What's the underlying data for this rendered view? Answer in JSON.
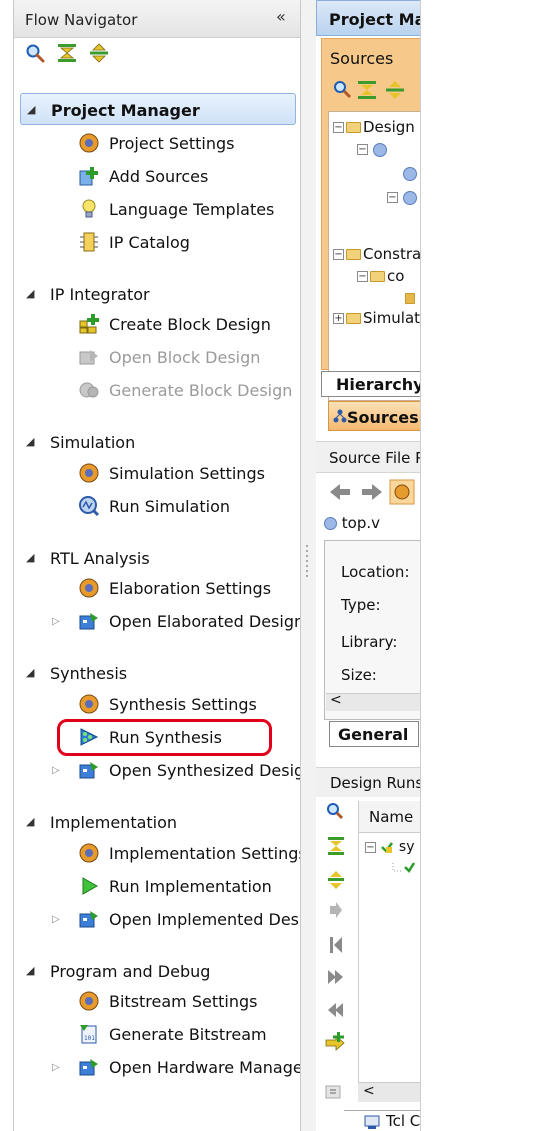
{
  "flow_navigator": {
    "title": "Flow Navigator",
    "collapse_glyph": "«",
    "toolbar": [
      "search-icon",
      "collapse-all-icon",
      "expand-all-icon"
    ],
    "sections": [
      {
        "label": "Project Manager",
        "selected": true,
        "items": [
          {
            "label": "Project Settings",
            "icon": "gear-icon"
          },
          {
            "label": "Add Sources",
            "icon": "add-sources-icon"
          },
          {
            "label": "Language Templates",
            "icon": "lightbulb-icon"
          },
          {
            "label": "IP Catalog",
            "icon": "ip-chip-icon"
          }
        ]
      },
      {
        "label": "IP Integrator",
        "items": [
          {
            "label": "Create Block Design",
            "icon": "create-block-design-icon"
          },
          {
            "label": "Open Block Design",
            "icon": "open-block-design-icon",
            "disabled": true
          },
          {
            "label": "Generate Block Design",
            "icon": "generate-block-design-icon",
            "disabled": true
          }
        ]
      },
      {
        "label": "Simulation",
        "items": [
          {
            "label": "Simulation Settings",
            "icon": "gear-icon"
          },
          {
            "label": "Run Simulation",
            "icon": "simulation-icon"
          }
        ]
      },
      {
        "label": "RTL Analysis",
        "items": [
          {
            "label": "Elaboration Settings",
            "icon": "gear-icon"
          },
          {
            "label": "Open Elaborated Design",
            "icon": "open-design-icon",
            "expandable": true
          }
        ]
      },
      {
        "label": "Synthesis",
        "items": [
          {
            "label": "Synthesis Settings",
            "icon": "gear-icon"
          },
          {
            "label": "Run Synthesis",
            "icon": "run-synthesis-icon",
            "highlighted": true
          },
          {
            "label": "Open Synthesized Design",
            "icon": "open-design-icon",
            "expandable": true
          }
        ]
      },
      {
        "label": "Implementation",
        "items": [
          {
            "label": "Implementation Settings",
            "icon": "gear-icon"
          },
          {
            "label": "Run Implementation",
            "icon": "play-icon"
          },
          {
            "label": "Open Implemented Design",
            "icon": "open-design-icon",
            "expandable": true
          }
        ]
      },
      {
        "label": "Program and Debug",
        "items": [
          {
            "label": "Bitstream Settings",
            "icon": "gear-icon"
          },
          {
            "label": "Generate Bitstream",
            "icon": "bitstream-icon"
          },
          {
            "label": "Open Hardware Manager",
            "icon": "open-design-icon",
            "expandable": true
          }
        ]
      }
    ]
  },
  "project_manager": {
    "header": "Project Manager",
    "sources": {
      "title": "Sources",
      "tree": [
        "Design Sources",
        "Constraints",
        "co",
        "Simulation Sources"
      ],
      "tabs": [
        "Hierarchy",
        "Sources"
      ]
    },
    "source_file": {
      "title": "Source File Properties",
      "file": "top.v",
      "props": [
        "Location:",
        "Type:",
        "Library:",
        "Size:"
      ],
      "tab": "General"
    },
    "design_runs": {
      "title": "Design Runs",
      "column": "Name",
      "row": "sy"
    },
    "tcl_tab": "Tcl Console"
  }
}
